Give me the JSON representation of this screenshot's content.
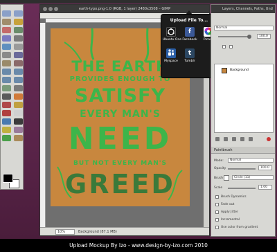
{
  "image_window": {
    "title": "earth-typo.png-1.0 (RGB, 1 layer) 2480x3508 – GIMP",
    "zoom": "10%",
    "status": "Background (87.1 MB)"
  },
  "poster": {
    "lines": [
      "THE EARTH",
      "PROVIDES ENOUGH TO",
      "SATISFY",
      "EVERY MAN'S",
      "NEED",
      "BUT NOT EVERY MAN'S",
      "GREED"
    ],
    "background_color": "#c8873e",
    "text_color": "#3db54a"
  },
  "share_popup": {
    "title": "Upload File To...",
    "services": [
      {
        "label": "Ubuntu One",
        "icon": "ubuntu-one-icon",
        "color": "#1a1a1a"
      },
      {
        "label": "Facebook",
        "icon": "facebook-icon",
        "color": "#3b5998"
      },
      {
        "label": "Picasa",
        "icon": "picasa-icon",
        "color": "#ffffff"
      },
      {
        "label": "Myspace",
        "icon": "myspace-icon",
        "color": "#2a5ea6"
      },
      {
        "label": "Tumblr",
        "icon": "tumblr-icon",
        "color": "#2c4762"
      }
    ]
  },
  "dock": {
    "title": "Layers, Channels, Paths, Und",
    "mode_value": "Normal",
    "opacity_value": "100.0",
    "layer_name": "Background",
    "paintbrush": {
      "title": "Paintbrush",
      "mode_label": "Mode:",
      "mode_value": "Normal",
      "opacity_label": "Opacity",
      "opacity_value": "100.0",
      "brush_label": "Brush",
      "brush_value": "Circle (11)",
      "scale_label": "Scale",
      "scale_value": "1.00",
      "options": [
        "Brush Dynamics",
        "Fade out",
        "Apply Jitter",
        "Incremental",
        "Use color from gradient"
      ]
    }
  },
  "credit": "Upload Mockup By Izo - www.design-by-izo.com 2010"
}
